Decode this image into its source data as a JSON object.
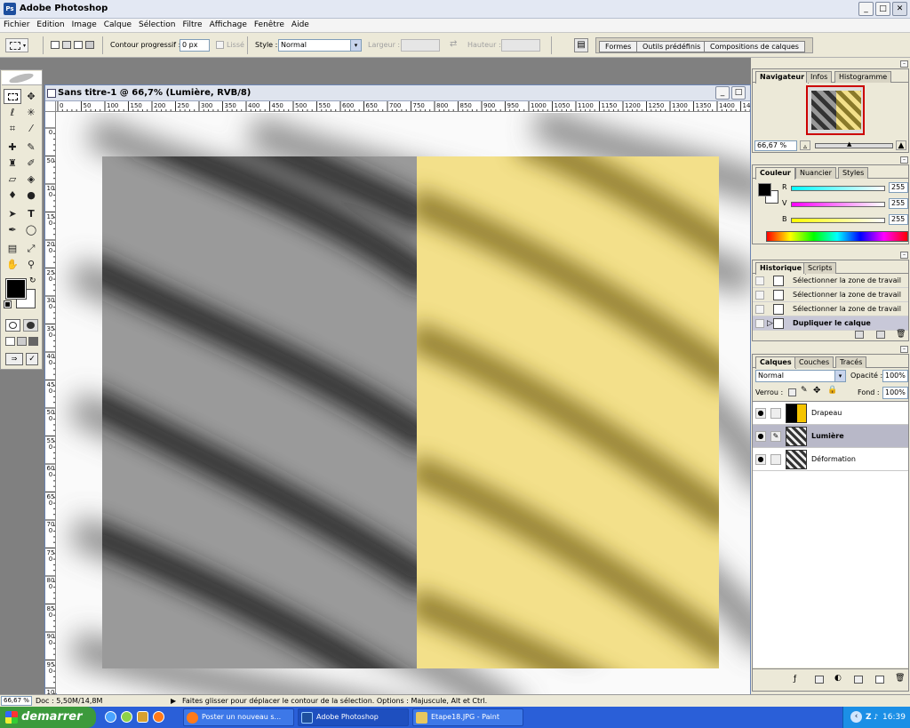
{
  "app": {
    "title": "Adobe Photoshop",
    "icon_label": "Ps"
  },
  "window_buttons": {
    "minimize": "_",
    "maximize": "□",
    "close": "✕"
  },
  "menu": [
    "Fichier",
    "Edition",
    "Image",
    "Calque",
    "Sélection",
    "Filtre",
    "Affichage",
    "Fenêtre",
    "Aide"
  ],
  "options": {
    "feather_label": "Contour progressif :",
    "feather_value": "0 px",
    "antialias_label": "Lissé",
    "style_label": "Style :",
    "style_value": "Normal",
    "width_label": "Largeur :",
    "height_label": "Hauteur :",
    "palette_tabs": [
      "Formes",
      "Outils prédéfinis",
      "Compositions de calques"
    ]
  },
  "document": {
    "title": "Sans titre-1 @ 66,7% (Lumière, RVB/8)",
    "hruler_labels": [
      "0",
      "50",
      "100",
      "150",
      "200",
      "250",
      "300",
      "350",
      "400",
      "450",
      "500",
      "550",
      "600",
      "650",
      "700",
      "750",
      "800",
      "850",
      "900",
      "950",
      "1000",
      "1050",
      "1100",
      "1150",
      "1200",
      "1250",
      "1300",
      "1350",
      "1400",
      "145"
    ],
    "vruler_labels": [
      "0",
      "50",
      "100",
      "150",
      "200",
      "250",
      "300",
      "350",
      "400",
      "450",
      "500",
      "550",
      "600",
      "650",
      "700",
      "750",
      "800",
      "850",
      "900",
      "950",
      "1000"
    ]
  },
  "navigator": {
    "tabs": [
      "Navigateur",
      "Infos",
      "Histogramme"
    ],
    "zoom": "66,67 %"
  },
  "color": {
    "tabs": [
      "Couleur",
      "Nuancier",
      "Styles"
    ],
    "channels": [
      {
        "label": "R",
        "value": "255"
      },
      {
        "label": "V",
        "value": "255"
      },
      {
        "label": "B",
        "value": "255"
      }
    ]
  },
  "history": {
    "tabs": [
      "Historique",
      "Scripts"
    ],
    "items": [
      "Sélectionner la zone de travail",
      "Sélectionner la zone de travail",
      "Sélectionner la zone de travail",
      "Dupliquer le calque"
    ]
  },
  "layers": {
    "tabs": [
      "Calques",
      "Couches",
      "Tracés"
    ],
    "blend_mode": "Normal",
    "opacity_label": "Opacité :",
    "opacity_value": "100%",
    "lock_label": "Verrou :",
    "fill_label": "Fond :",
    "fill_value": "100%",
    "items": [
      {
        "name": "Drapeau"
      },
      {
        "name": "Lumière"
      },
      {
        "name": "Déformation"
      }
    ]
  },
  "status": {
    "zoom": "66,67 %",
    "doc": "Doc : 5,50M/14,8M",
    "hint": "Faites glisser pour déplacer le contour de la sélection. Options : Majuscule, Alt et Ctrl."
  },
  "taskbar": {
    "start": "demarrer",
    "tasks": [
      "Poster un nouveau s...",
      "Adobe Photoshop",
      "Etape18.JPG - Paint"
    ],
    "time": "16:39"
  },
  "colors": {
    "flag_yellow": "#f3e08a",
    "flag_grey": "#9a9a9a",
    "taskbar_blue": "#2a5fd8",
    "start_green": "#3c9a3c"
  }
}
